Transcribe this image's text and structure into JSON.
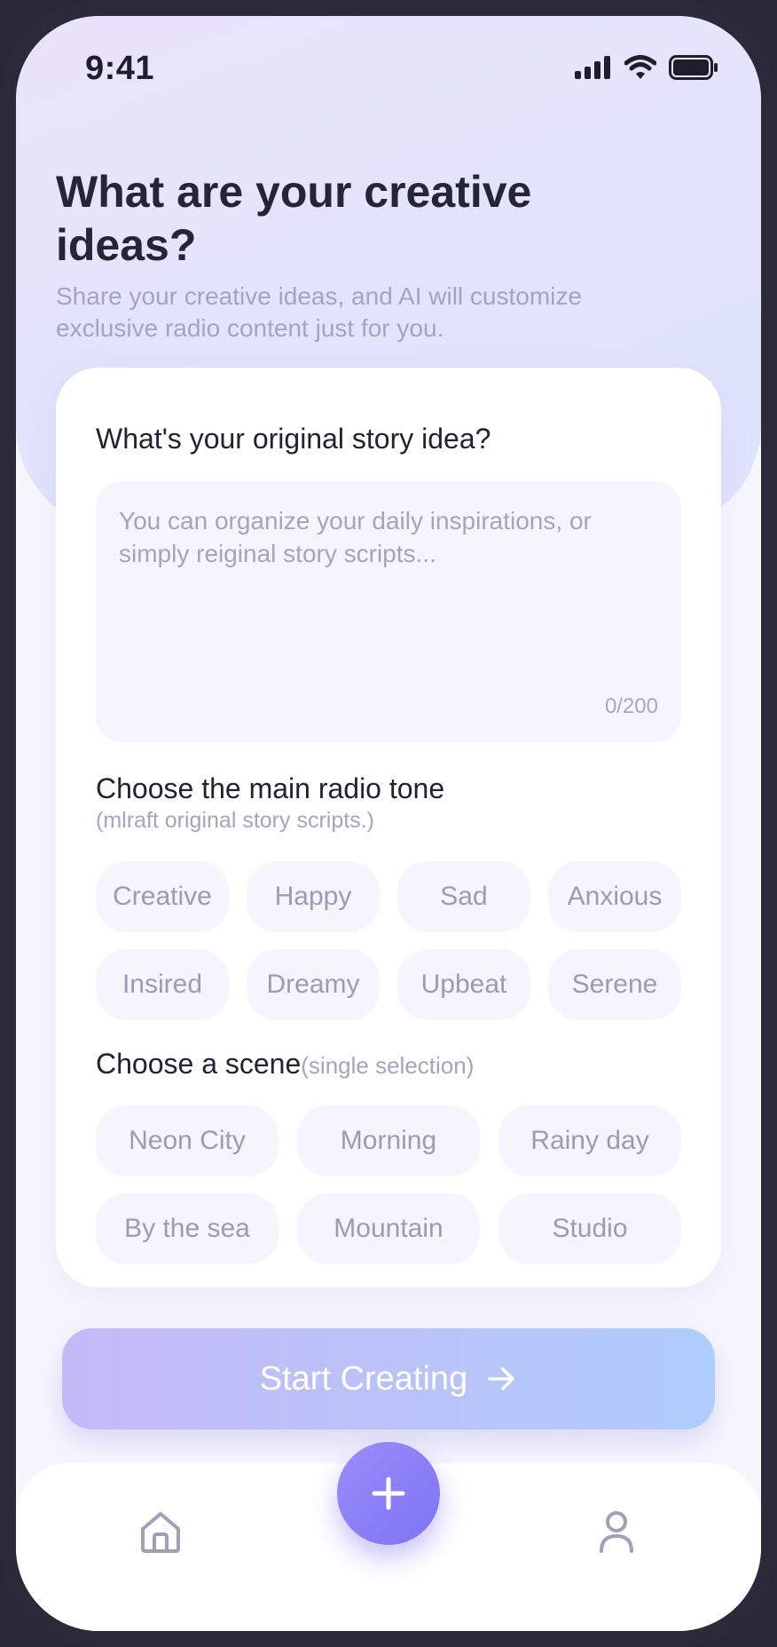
{
  "status_bar": {
    "time": "9:41"
  },
  "header": {
    "title": "What are your creative ideas?",
    "subtitle": "Share your creative ideas, and AI will customize exclusive radio content just for you."
  },
  "story": {
    "label": "What's your original story idea?",
    "placeholder": "You can organize your daily inspirations, or simply reiginal story scripts...",
    "value": "",
    "counter": "0/200"
  },
  "tone": {
    "label": "Choose the main radio tone",
    "sublabel": "(mlraft original story scripts.)",
    "options": [
      "Creative",
      "Happy",
      "Sad",
      "Anxious",
      "Insired",
      "Dreamy",
      "Upbeat",
      "Serene"
    ]
  },
  "scene": {
    "label": "Choose a scene",
    "hint": "(single selection)",
    "options": [
      "Neon City",
      "Morning",
      "Rainy day",
      "By the sea",
      "Mountain",
      "Studio"
    ]
  },
  "cta": {
    "label": "Start Creating"
  },
  "tabbar": {
    "items": [
      {
        "icon": "home-icon"
      },
      {
        "icon": "plus-icon"
      },
      {
        "icon": "profile-icon"
      }
    ]
  },
  "colors": {
    "accent": "#8a7ff7",
    "chip_bg": "#f6f4fd",
    "chip_text": "#9c9ab6",
    "button_gradient_start": "#c5baf8",
    "button_gradient_end": "#aecdfa"
  }
}
